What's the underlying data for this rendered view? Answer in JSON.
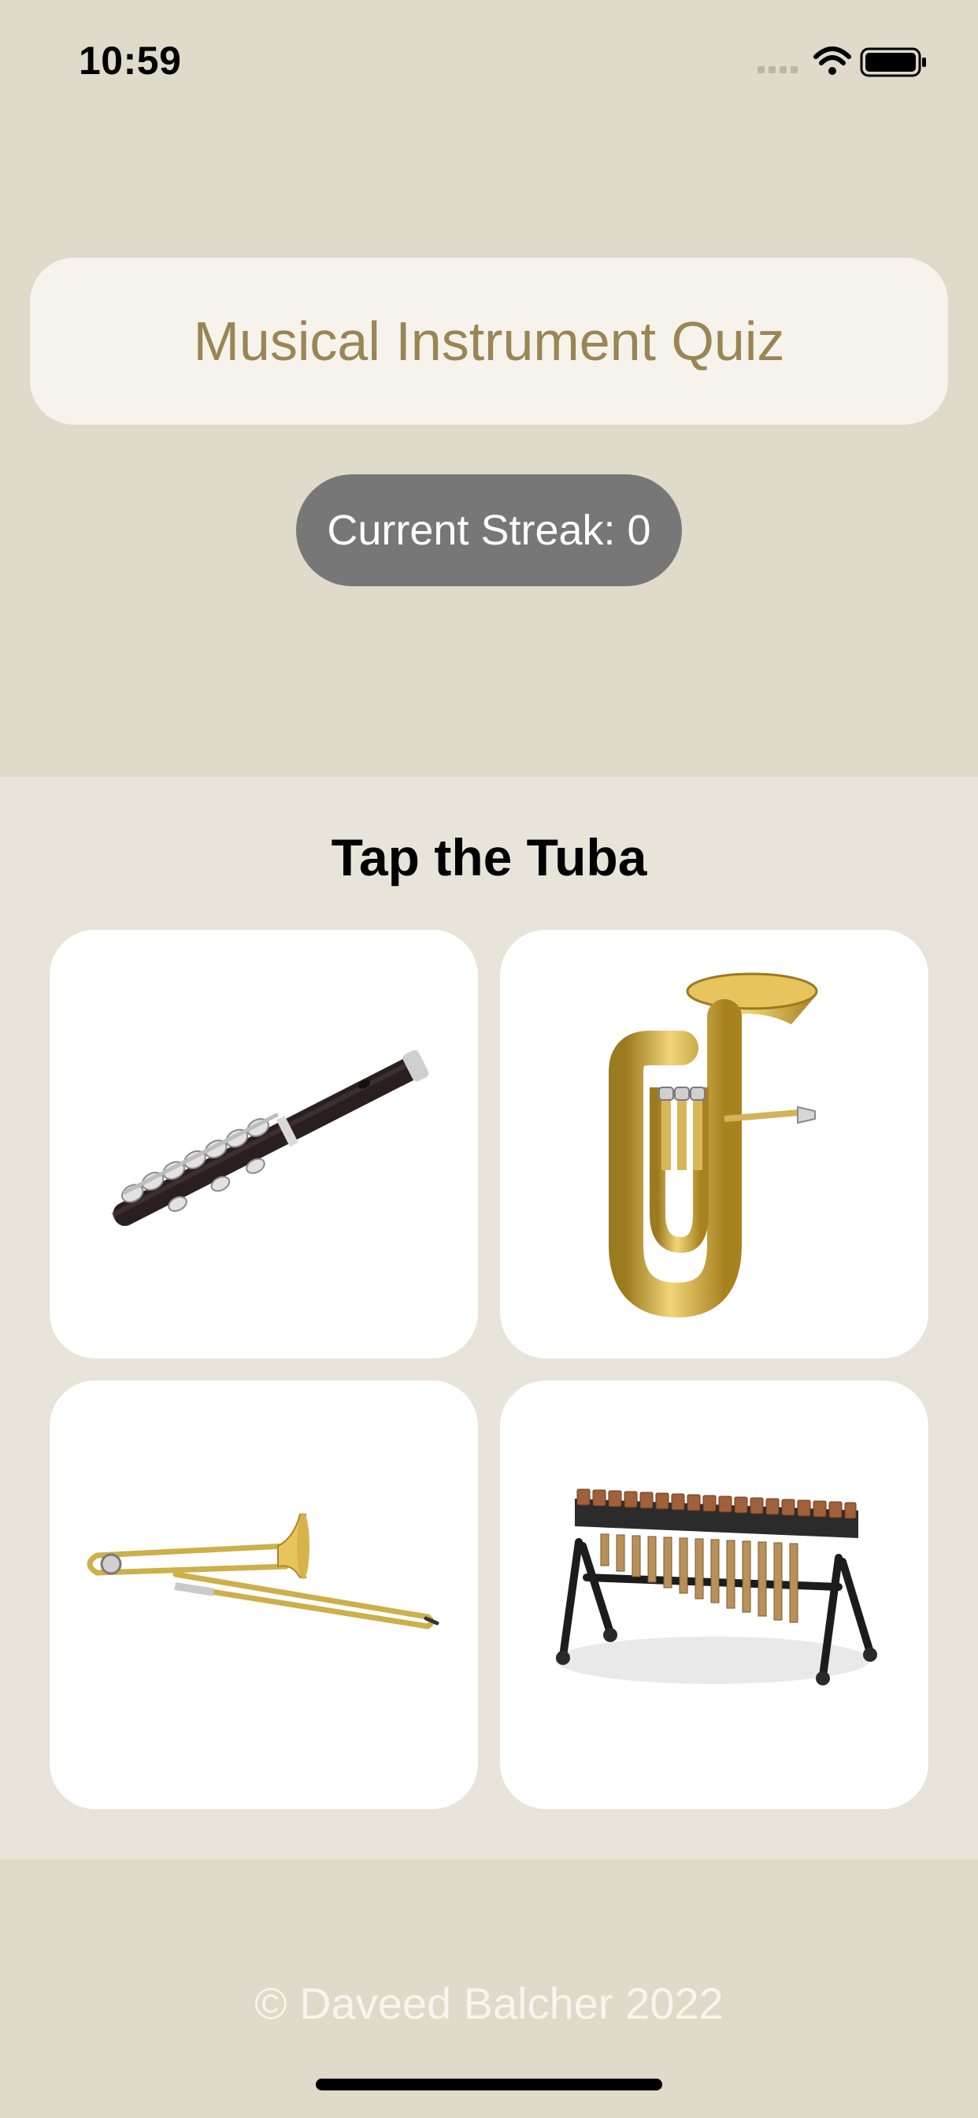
{
  "status_bar": {
    "time": "10:59",
    "icons": [
      "cellular-signal-icon",
      "wifi-icon",
      "battery-icon"
    ]
  },
  "header": {
    "title": "Musical Instrument Quiz",
    "streak": "Current Streak: 0"
  },
  "quiz": {
    "prompt": "Tap the Tuba",
    "options": [
      {
        "instrument": "flute-image"
      },
      {
        "instrument": "tuba-image"
      },
      {
        "instrument": "trombone-image"
      },
      {
        "instrument": "marimba-image"
      }
    ]
  },
  "footer": {
    "copyright": "© Daveed Balcher 2022"
  },
  "colors": {
    "background": "#dfdac9",
    "panel": "#e8e4da",
    "title_card": "#f5f3ec",
    "title_text": "#9a8654",
    "streak_pill": "#777777",
    "tile": "#ffffff"
  }
}
